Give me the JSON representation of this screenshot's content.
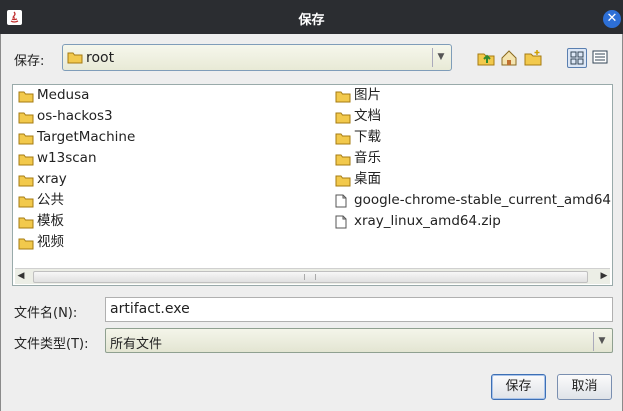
{
  "window": {
    "title": "保存"
  },
  "lookin": {
    "label": "保存:",
    "value": "root"
  },
  "files": {
    "col1": [
      {
        "name": "Medusa",
        "icon": "folder-icon"
      },
      {
        "name": "os-hackos3",
        "icon": "folder-icon"
      },
      {
        "name": "TargetMachine",
        "icon": "folder-icon"
      },
      {
        "name": "w13scan",
        "icon": "folder-icon"
      },
      {
        "name": "xray",
        "icon": "folder-icon"
      },
      {
        "name": "公共",
        "icon": "folder-icon"
      },
      {
        "name": "模板",
        "icon": "folder-icon"
      },
      {
        "name": "视频",
        "icon": "folder-icon"
      }
    ],
    "col2": [
      {
        "name": "图片",
        "icon": "folder-icon"
      },
      {
        "name": "文档",
        "icon": "folder-icon"
      },
      {
        "name": "下载",
        "icon": "folder-icon"
      },
      {
        "name": "音乐",
        "icon": "folder-icon"
      },
      {
        "name": "桌面",
        "icon": "folder-icon"
      },
      {
        "name": "google-chrome-stable_current_amd64",
        "icon": "file-icon"
      },
      {
        "name": "xray_linux_amd64.zip",
        "icon": "file-icon"
      }
    ]
  },
  "filename": {
    "label": "文件名(N):",
    "value": "artifact.exe"
  },
  "filetype": {
    "label": "文件类型(T):",
    "value": "所有文件"
  },
  "buttons": {
    "save": "保存",
    "cancel": "取消"
  },
  "colors": {
    "titlebar": "#2b2d31",
    "close": "#2d6fd6",
    "folder": "#f2c94c"
  }
}
